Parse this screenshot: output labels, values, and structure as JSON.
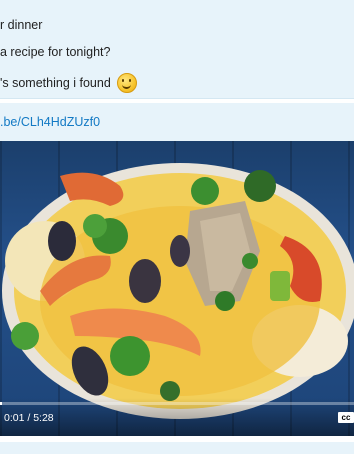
{
  "messages": [
    {
      "text": "r dinner"
    },
    {
      "text": "a recipe for tonight?"
    },
    {
      "text": "'s something i found",
      "emoji": "smiling-face-icon"
    }
  ],
  "link": {
    "text": ".be/CLh4HdZUzf0"
  },
  "video": {
    "time": "0:01 / 5:28",
    "cc_label": "cc",
    "progress_fraction": 0.003
  },
  "colors": {
    "bubble": "#e7f3fa",
    "link": "#1279c4",
    "table": "#1f4a82"
  }
}
